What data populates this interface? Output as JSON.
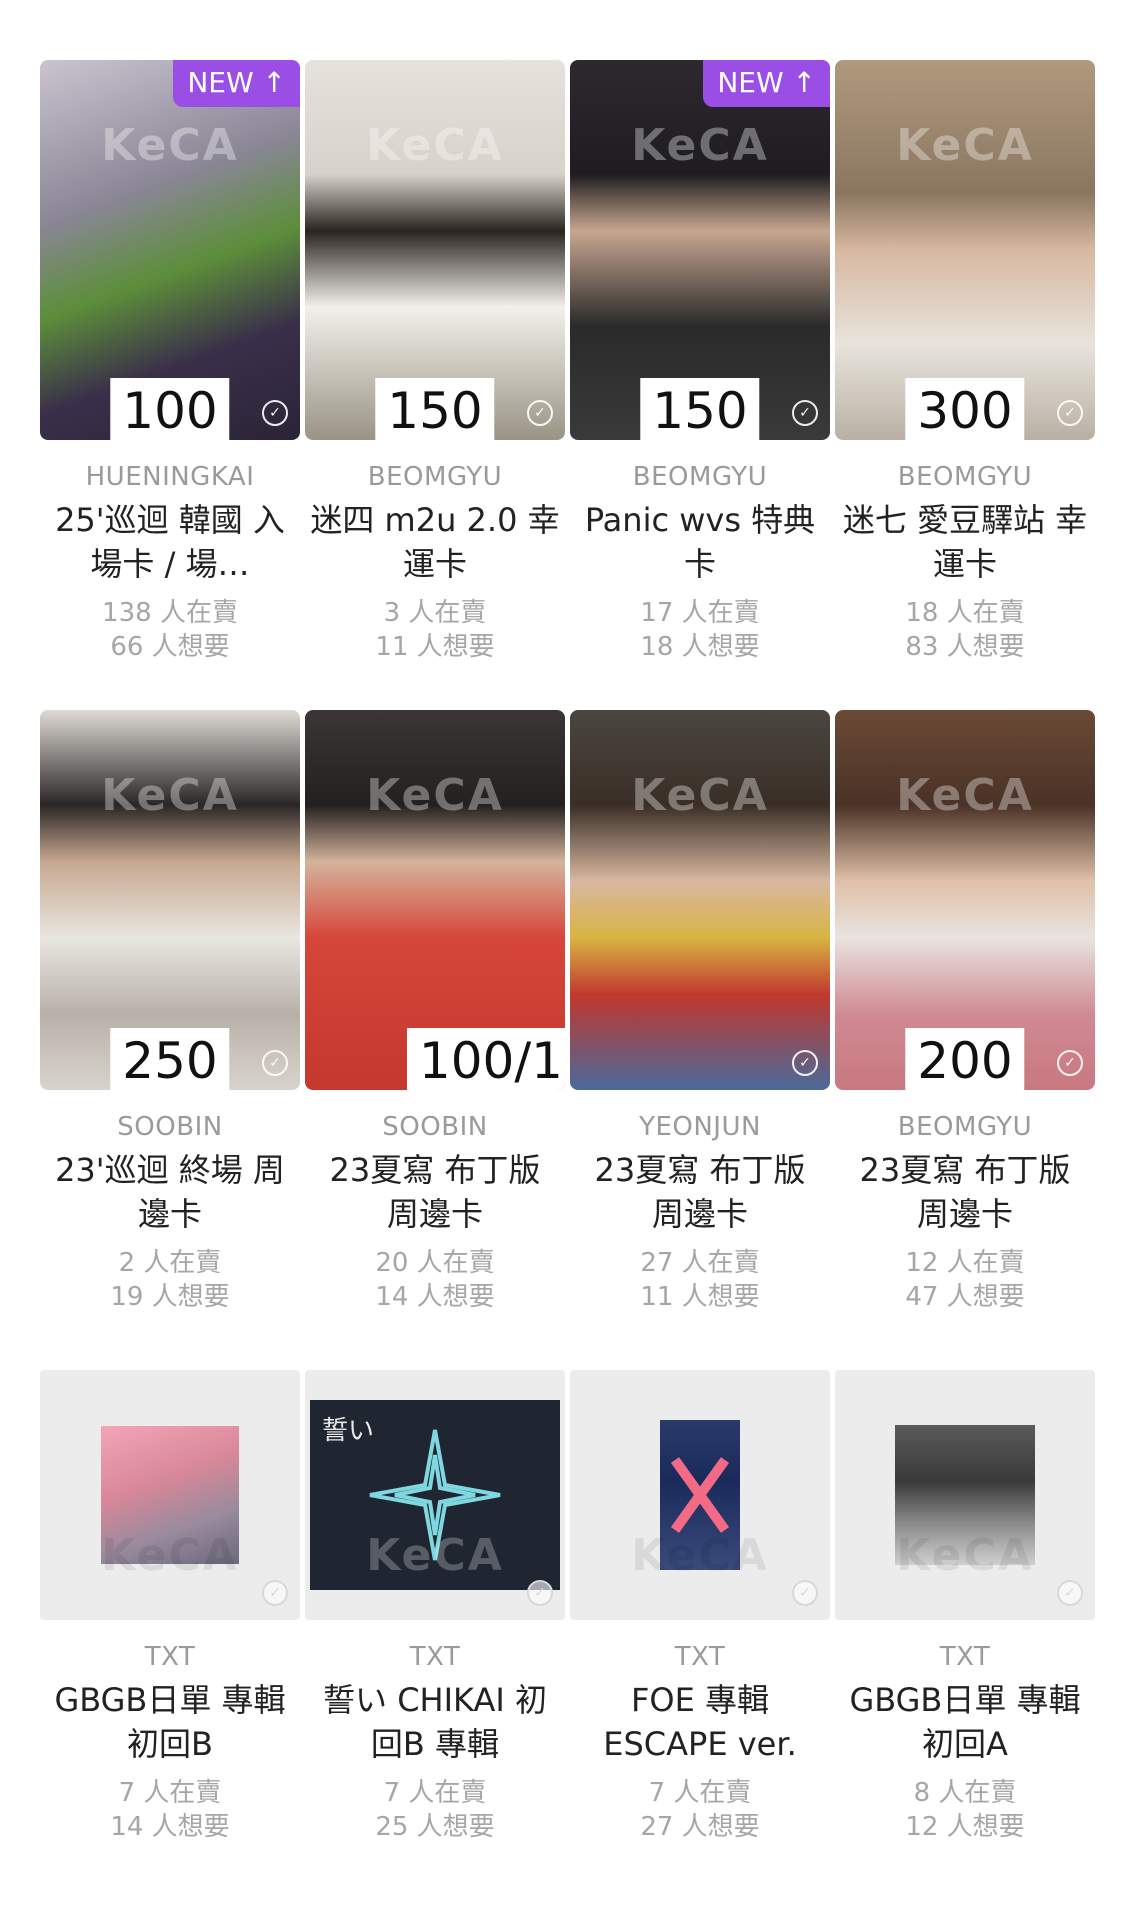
{
  "badge_new": "NEW ↑",
  "watermark_text": "KeCA",
  "cards": [
    {
      "artist": "HUENINGKAI",
      "title": "25'巡迴 韓國 入場卡 / 場…",
      "selling": "138 人在賣",
      "wanting": "66 人想要",
      "price": "100",
      "new": true
    },
    {
      "artist": "BEOMGYU",
      "title": "迷四 m2u 2.0 幸運卡",
      "selling": "3 人在賣",
      "wanting": "11 人想要",
      "price": "150",
      "new": false
    },
    {
      "artist": "BEOMGYU",
      "title": "Panic wvs 特典卡",
      "selling": "17 人在賣",
      "wanting": "18 人想要",
      "price": "150",
      "new": true
    },
    {
      "artist": "BEOMGYU",
      "title": "迷七 愛豆驛站 幸運卡",
      "selling": "18 人在賣",
      "wanting": "83 人想要",
      "price": "300",
      "new": false
    },
    {
      "artist": "SOOBIN",
      "title": "23'巡迴 終場 周邊卡",
      "selling": "2 人在賣",
      "wanting": "19 人想要",
      "price": "250",
      "new": false
    },
    {
      "artist": "SOOBIN",
      "title": "23夏寫 布丁版 周邊卡",
      "selling": "20 人在賣",
      "wanting": "14 人想要",
      "price": "100/1",
      "new": false
    },
    {
      "artist": "YEONJUN",
      "title": "23夏寫 布丁版 周邊卡",
      "selling": "27 人在賣",
      "wanting": "11 人想要",
      "price": "",
      "new": false
    },
    {
      "artist": "BEOMGYU",
      "title": "23夏寫 布丁版 周邊卡",
      "selling": "12 人在賣",
      "wanting": "47 人想要",
      "price": "200",
      "new": false
    },
    {
      "artist": "TXT",
      "title": "GBGB日單 專輯 初回B",
      "selling": "7 人在賣",
      "wanting": "14 人想要",
      "price": "",
      "new": false
    },
    {
      "artist": "TXT",
      "title": "誓い CHIKAI 初回B 專輯",
      "selling": "7 人在賣",
      "wanting": "25 人想要",
      "price": "",
      "new": false
    },
    {
      "artist": "TXT",
      "title": "FOE 專輯 ESCAPE ver.",
      "selling": "7 人在賣",
      "wanting": "27 人想要",
      "price": "",
      "new": false
    },
    {
      "artist": "TXT",
      "title": "GBGB日單 專輯 初回A",
      "selling": "8 人在賣",
      "wanting": "12 人想要",
      "price": "",
      "new": false
    }
  ],
  "album_labels": {
    "chikai": "誓い"
  },
  "colors": {
    "badge": "#9a4ee6",
    "artist_text": "#9a9a9a",
    "title_text": "#222222",
    "stat_text": "#a6a6a6"
  }
}
